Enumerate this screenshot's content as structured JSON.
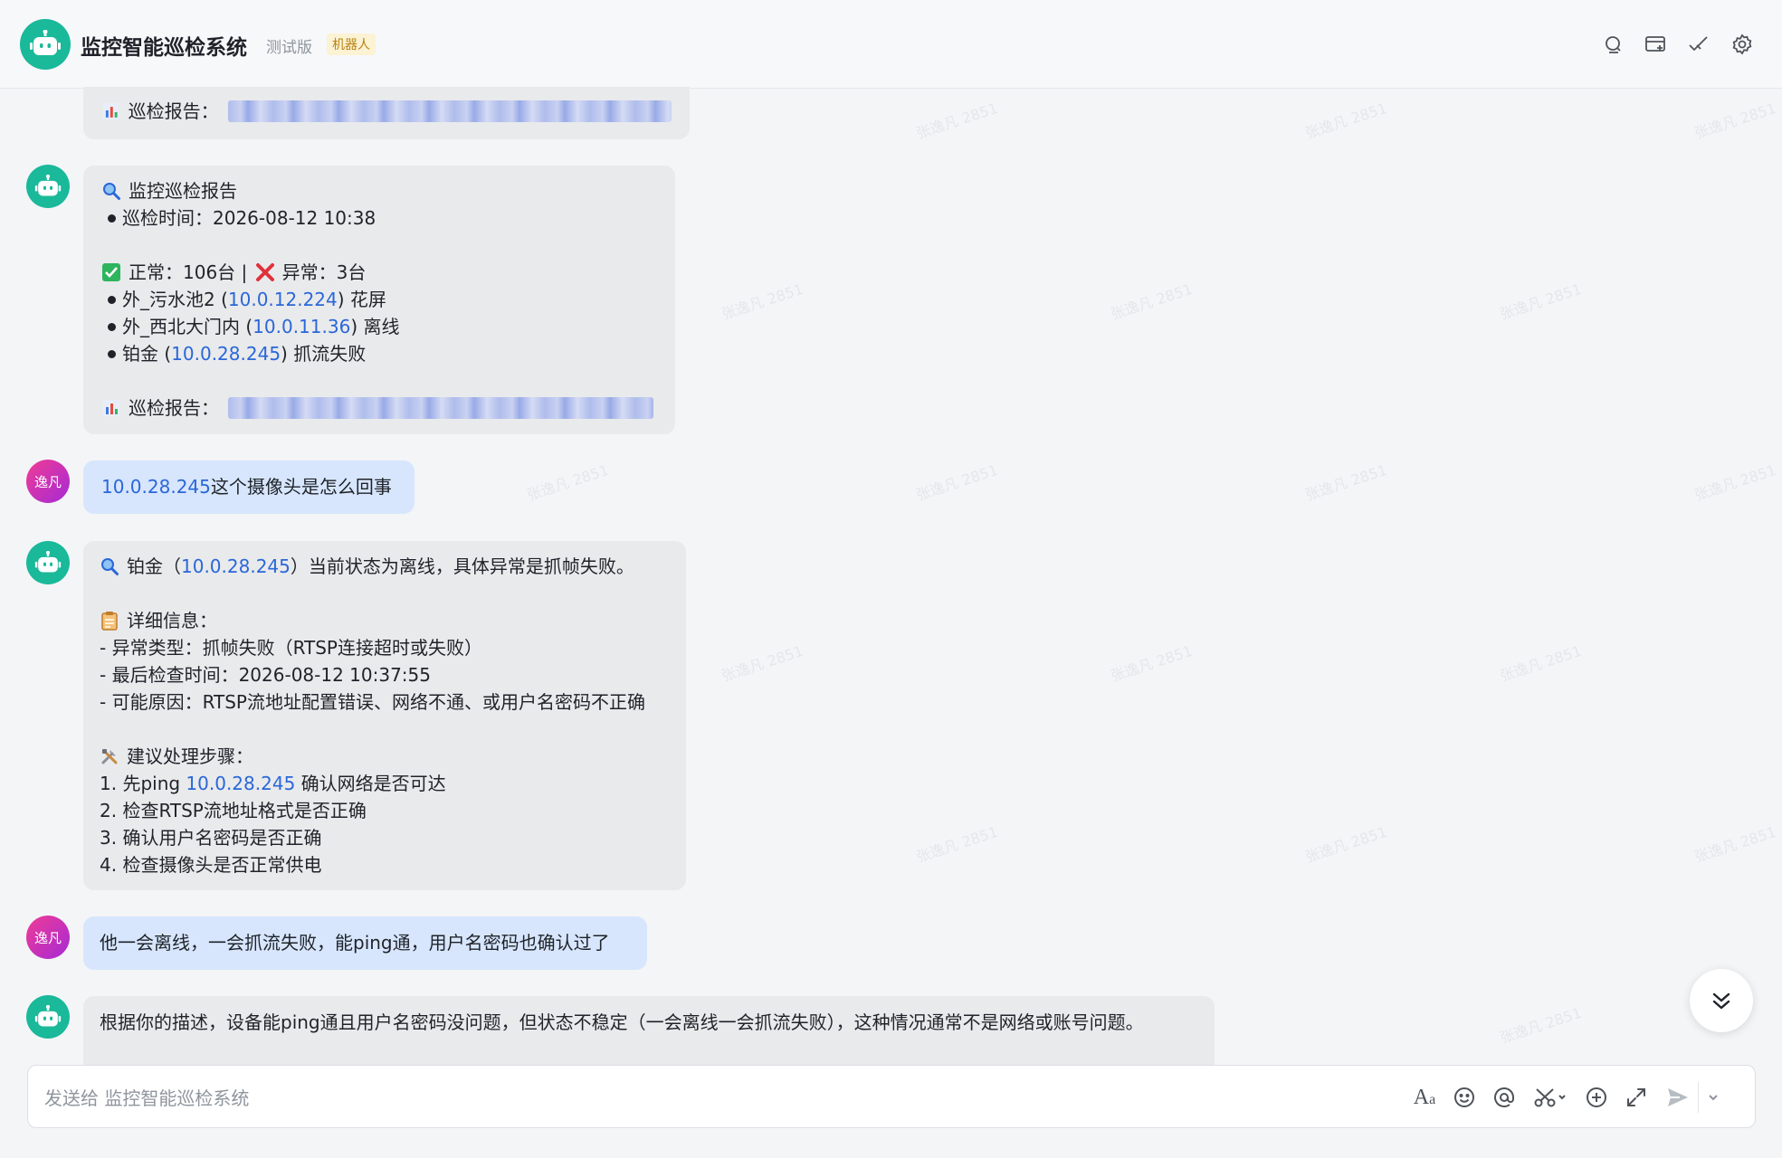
{
  "header": {
    "title": "监控智能巡检系统",
    "tag_test": "测试版",
    "tag_bot": "机器人",
    "icons": [
      "search-icon",
      "add-chat-icon",
      "check-icon",
      "settings-icon"
    ]
  },
  "messages": {
    "m0": {
      "report_label": "巡检报告："
    },
    "m1": {
      "title": "监控巡检报告",
      "time": "巡检时间：2026-08-12 10:38",
      "summary_normal": "正常：106台",
      "summary_sep": " | ",
      "summary_abnormal": "异常：3台",
      "items": [
        {
          "name": "外_污水池2 (",
          "ip": "10.0.12.224",
          "status": ") 花屏"
        },
        {
          "name": "外_西北大门内 (",
          "ip": "10.0.11.36",
          "status": ") 离线"
        },
        {
          "name": "铂金 (",
          "ip": "10.0.28.245",
          "status": ") 抓流失败"
        }
      ],
      "report_label": "巡检报告："
    },
    "m2": {
      "avatar": "逸凡",
      "ip": "10.0.28.245",
      "text": "这个摄像头是怎么回事"
    },
    "m3": {
      "line1_a": "铂金（",
      "line1_ip": "10.0.28.245",
      "line1_b": "）当前状态为离线，具体异常是抓帧失败。",
      "detail_title": "详细信息：",
      "details": [
        "- 异常类型：抓帧失败（RTSP连接超时或失败）",
        "- 最后检查时间：2026-08-12 10:37:55",
        "- 可能原因：RTSP流地址配置错误、网络不通、或用户名密码不正确"
      ],
      "steps_title": "建议处理步骤：",
      "step1_a": "1. 先ping ",
      "step1_ip": "10.0.28.245",
      "step1_b": " 确认网络是否可达",
      "steps": [
        "2. 检查RTSP流地址格式是否正确",
        "3. 确认用户名密码是否正确",
        "4. 检查摄像头是否正常供电"
      ]
    },
    "m4": {
      "avatar": "逸凡",
      "text": "他一会离线，一会抓流失败，能ping通，用户名密码也确认过了"
    },
    "m5": {
      "text": "根据你的描述，设备能ping通且用户名密码没问题，但状态不稳定（一会离线一会抓流失败），这种情况通常不是网络或账号问题。"
    }
  },
  "input": {
    "placeholder": "发送给 监控智能巡检系统",
    "tools": [
      "font-format-icon",
      "emoji-icon",
      "mention-icon",
      "screenshot-icon",
      "add-icon",
      "expand-icon",
      "send-icon",
      "chevron-down-icon"
    ]
  },
  "watermark": "张逸凡 2851",
  "colors": {
    "brand_green": "#19b99a",
    "link_blue": "#2a67d8",
    "user_bubble": "#d7e6fd",
    "bot_bubble": "#e9eaec"
  }
}
